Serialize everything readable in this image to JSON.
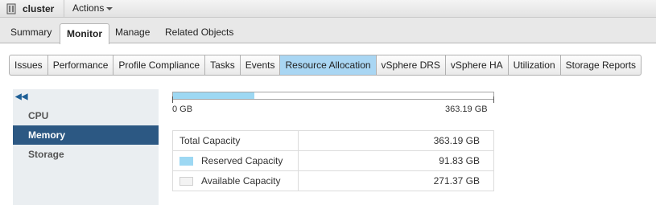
{
  "header": {
    "object_name": "cluster",
    "object_icon": "cluster-icon",
    "actions_label": "Actions"
  },
  "main_tabs": [
    {
      "label": "Summary",
      "active": false
    },
    {
      "label": "Monitor",
      "active": true
    },
    {
      "label": "Manage",
      "active": false
    },
    {
      "label": "Related Objects",
      "active": false
    }
  ],
  "sub_tabs": [
    {
      "label": "Issues",
      "active": false
    },
    {
      "label": "Performance",
      "active": false
    },
    {
      "label": "Profile Compliance",
      "active": false
    },
    {
      "label": "Tasks",
      "active": false
    },
    {
      "label": "Events",
      "active": false
    },
    {
      "label": "Resource Allocation",
      "active": true
    },
    {
      "label": "vSphere DRS",
      "active": false
    },
    {
      "label": "vSphere HA",
      "active": false
    },
    {
      "label": "Utilization",
      "active": false
    },
    {
      "label": "Storage Reports",
      "active": false
    }
  ],
  "left_nav": {
    "collapse_icon": "double-chevron-left-icon",
    "items": [
      {
        "label": "CPU",
        "active": false
      },
      {
        "label": "Memory",
        "active": true
      },
      {
        "label": "Storage",
        "active": false
      }
    ]
  },
  "capacity_bar": {
    "min_label": "0 GB",
    "max_label": "363.19 GB",
    "reserved_gb": 91.83,
    "total_gb": 363.19
  },
  "capacity_table": {
    "rows": [
      {
        "label": "Total Capacity",
        "value": "363.19 GB",
        "swatch": null
      },
      {
        "label": "Reserved Capacity",
        "value": "91.83 GB",
        "swatch": "#9dd8f3"
      },
      {
        "label": "Available Capacity",
        "value": "271.37 GB",
        "swatch": "#f3f3f3"
      }
    ]
  },
  "colors": {
    "accent_selected_tab": "#a9d6f3",
    "nav_selected": "#2c5883",
    "reserved": "#9dd8f3",
    "available": "#f3f3f3"
  }
}
